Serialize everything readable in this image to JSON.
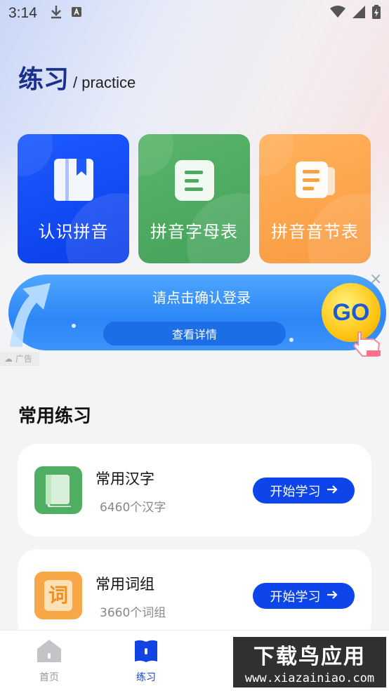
{
  "status": {
    "time": "3:14"
  },
  "header": {
    "title_cn": "练习",
    "title_en": "/ practice"
  },
  "cards": [
    {
      "label": "认识拼音",
      "icon": "book-icon",
      "color": "#1d5bff"
    },
    {
      "label": "拼音字母表",
      "icon": "list-icon",
      "color": "#52ac63"
    },
    {
      "label": "拼音音节表",
      "icon": "document-icon",
      "color": "#fca84d"
    }
  ],
  "ad": {
    "title": "请点击确认登录",
    "button": "查看详情",
    "go": "GO",
    "tag": "广告"
  },
  "section": {
    "title": "常用练习"
  },
  "items": [
    {
      "title": "常用汉字",
      "subtitle": "6460个汉字",
      "button": "开始学习",
      "icon": "book-icon",
      "color": "#4fae62"
    },
    {
      "title": "常用词组",
      "subtitle": "3660个词组",
      "button": "开始学习",
      "icon": "ci-character-icon",
      "icon_text": "词",
      "color": "#f8a748"
    }
  ],
  "tabbar": {
    "items": [
      {
        "label": "首页",
        "icon": "home-icon",
        "active": false
      },
      {
        "label": "练习",
        "icon": "practice-book-icon",
        "active": true
      }
    ]
  },
  "watermark": {
    "cn": "下载鸟应用",
    "en": "www.xiazainiao.com"
  },
  "colors": {
    "accent": "#0d45ea",
    "title": "#1b2f8c"
  }
}
